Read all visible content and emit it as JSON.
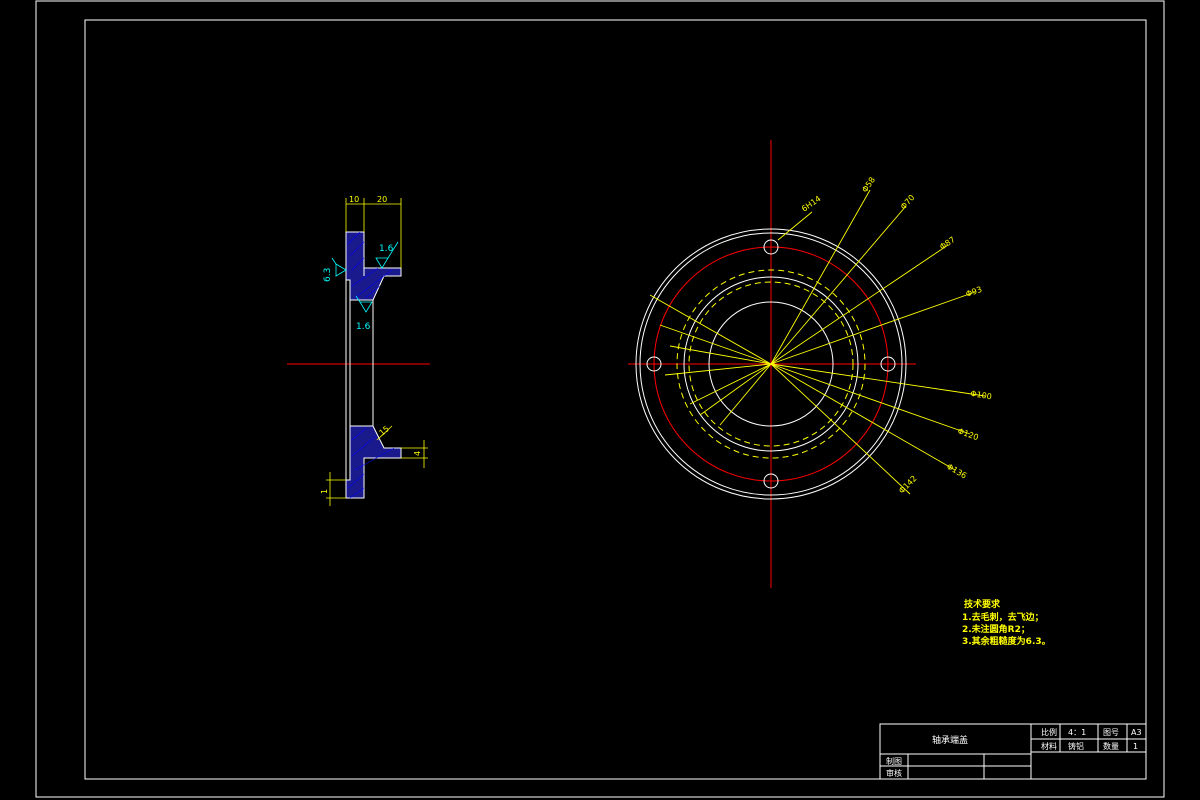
{
  "colors": {
    "background": "#000000",
    "outline": "#ffffff",
    "dimension": "#ffff00",
    "centerline": "#ff0000",
    "hatch_fill": "#1a1a8c",
    "roughness": "#00ffff"
  },
  "section_view": {
    "dims": {
      "width_left": "10",
      "width_right": "20",
      "chamfer": "15",
      "step": "4",
      "lip": "1"
    },
    "roughness": {
      "top": "1.6",
      "left": "6.3",
      "bottom": "1.6"
    }
  },
  "front_view": {
    "dims": {
      "holes": "6H14",
      "d1": "Φ58",
      "d2": "Φ70",
      "d3": "Φ87",
      "d4": "Φ93",
      "d5": "Φ100",
      "d6": "Φ120",
      "d7": "Φ136",
      "d8": "Φ142"
    }
  },
  "notes": {
    "title": "技术要求",
    "items": [
      "1.去毛刺，去飞边；",
      "2.未注圆角R2；",
      "3.其余粗糙度为6.3。"
    ]
  },
  "title_block": {
    "part_name": "轴承端盖",
    "scale_label": "比例",
    "scale_value": "4：1",
    "drawing_no_label": "图号",
    "drawing_no_value": "A3",
    "material_label": "材料",
    "material_value": "铸铝",
    "quantity_label": "数量",
    "quantity_value": "1",
    "drawn_label": "制图",
    "checked_label": "审核"
  }
}
